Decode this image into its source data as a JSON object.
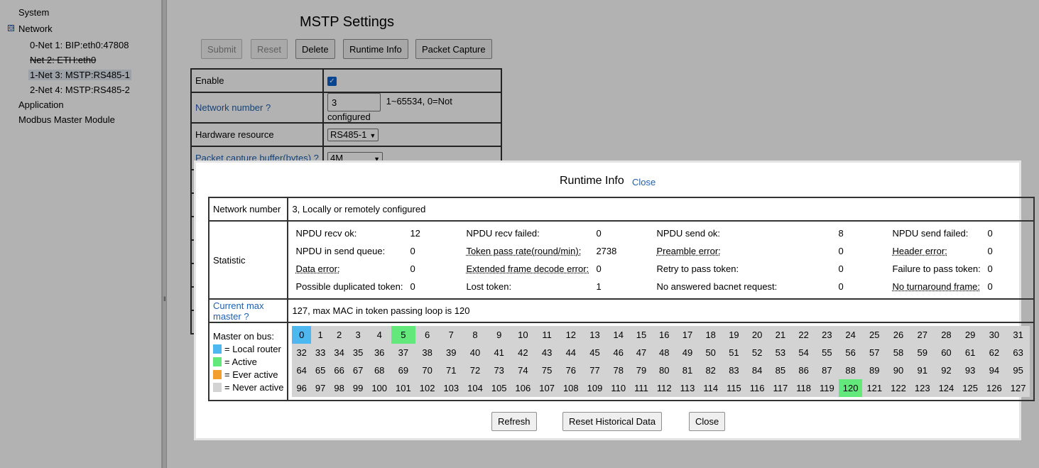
{
  "sidebar": {
    "items": [
      {
        "label": "System"
      },
      {
        "label": "Network",
        "toggle": "⊖"
      },
      {
        "label": "0-Net 1: BIP:eth0:47808"
      },
      {
        "label": "Net 2: ETH:eth0"
      },
      {
        "label": "1-Net 3: MSTP:RS485-1"
      },
      {
        "label": "2-Net 4: MSTP:RS485-2"
      },
      {
        "label": "Application"
      },
      {
        "label": "Modbus Master Module"
      }
    ]
  },
  "page": {
    "title": "MSTP Settings",
    "buttons": {
      "submit": "Submit",
      "reset": "Reset",
      "delete": "Delete",
      "runtime_info": "Runtime Info",
      "packet_capture": "Packet Capture"
    }
  },
  "settings": {
    "enable_label": "Enable",
    "enable_checked": true,
    "network_number_label": "Network number ?",
    "network_number_value": "3",
    "network_number_hint": "1~65534, 0=Not configured",
    "hardware_label": "Hardware resource",
    "hardware_value": "RS485-1",
    "capture_label": "Packet capture buffer(bytes) ?",
    "capture_value": "4M"
  },
  "dialog": {
    "title": "Runtime Info",
    "close_link": "Close",
    "network_number_label": "Network number",
    "network_number_value": "3, Locally or remotely configured",
    "statistic_label": "Statistic",
    "stats": [
      [
        "NPDU recv ok:",
        "12",
        "NPDU recv failed:",
        "0",
        "NPDU send ok:",
        "8",
        "NPDU send failed:",
        "0"
      ],
      [
        "NPDU in send queue:",
        "0",
        "Token pass rate(round/min):",
        "2738",
        "Preamble error:",
        "0",
        "Header error:",
        "0"
      ],
      [
        "Data error:",
        "0",
        "Extended frame decode error:",
        "0",
        "Retry to pass token:",
        "0",
        "Failure to pass token:",
        "0"
      ],
      [
        "Possible duplicated token:",
        "0",
        "Lost token:",
        "1",
        "No answered bacnet request:",
        "0",
        "No turnaround frame:",
        "0"
      ]
    ],
    "max_master_label": "Current max master ?",
    "max_master_value": "127, max MAC in token passing loop is 120",
    "master_on_bus_label": "Master on bus:",
    "legend": [
      {
        "text": "= Local router",
        "color": "#4db8ef"
      },
      {
        "text": "= Active",
        "color": "#63e87b"
      },
      {
        "text": "= Ever active",
        "color": "#f29f2d"
      },
      {
        "text": "= Never active",
        "color": "#d3d3d3"
      }
    ],
    "mac_count": 128,
    "local_router_macs": [
      0
    ],
    "active_macs": [
      5,
      120
    ],
    "ever_active_macs": [],
    "buttons": {
      "refresh": "Refresh",
      "reset_historical": "Reset Historical Data",
      "close": "Close"
    }
  }
}
